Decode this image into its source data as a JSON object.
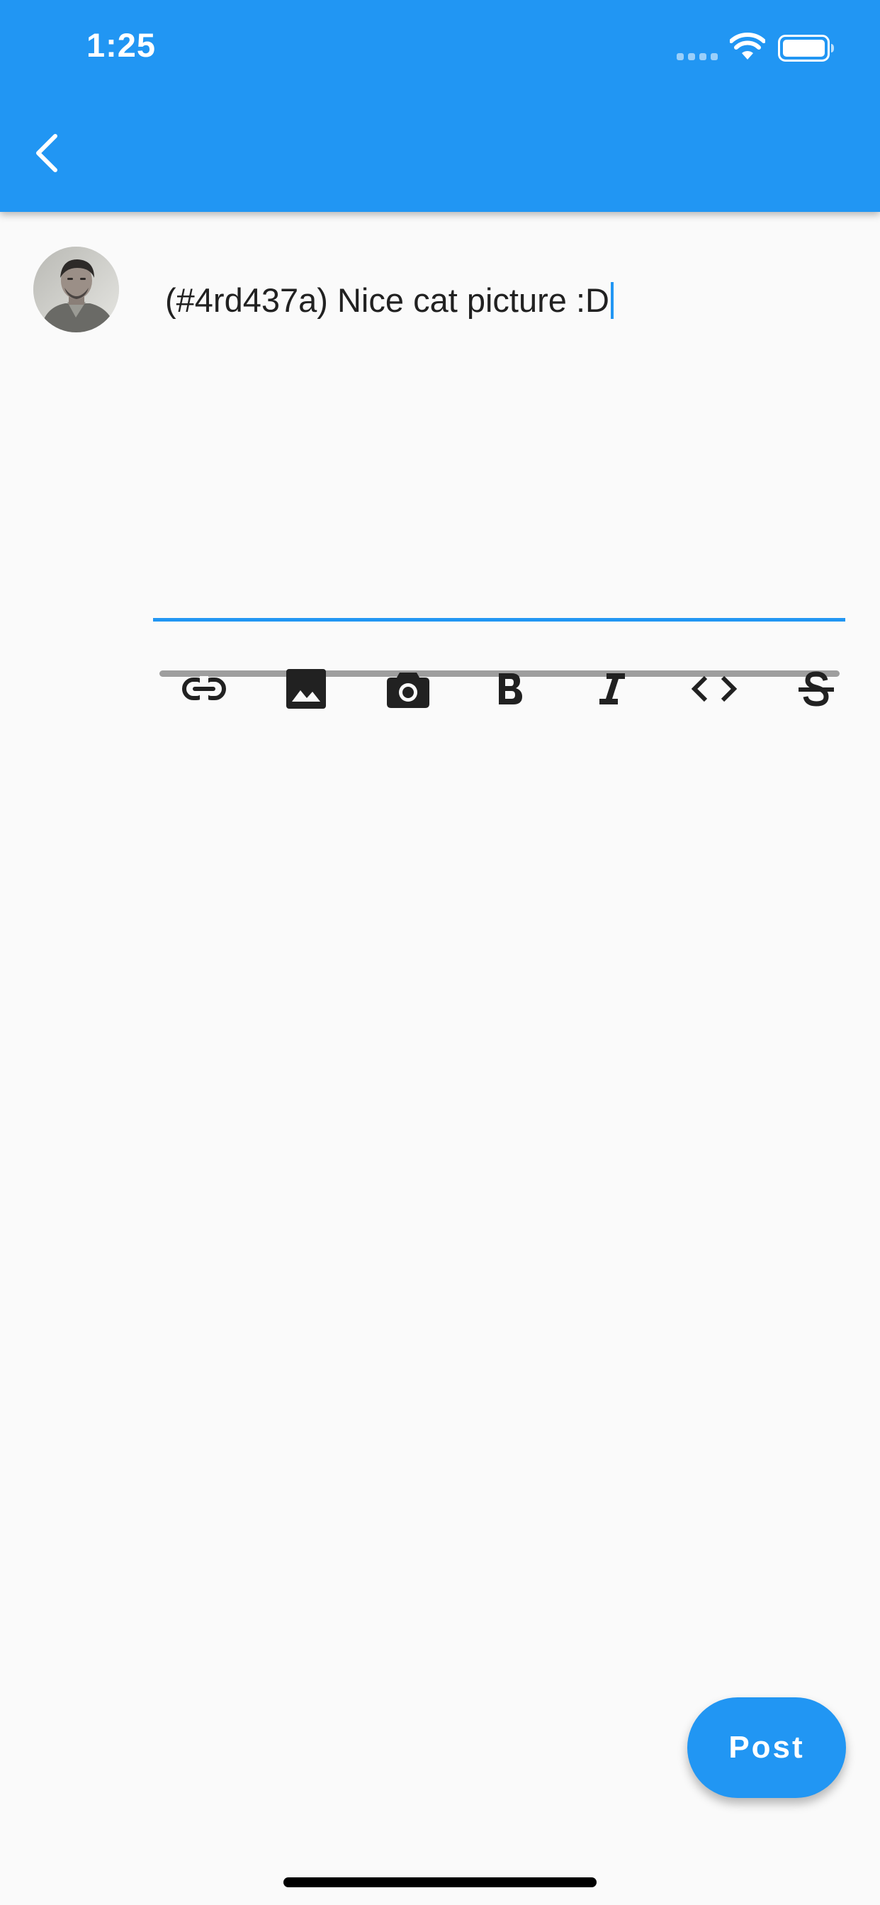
{
  "status_bar": {
    "time": "1:25",
    "icons": [
      "signal-dots-icon",
      "wifi-icon",
      "battery-icon"
    ]
  },
  "app_bar": {
    "back_icon": "chevron-left-icon"
  },
  "composer": {
    "avatar": "user-avatar",
    "text": "(#4rd437a) Nice cat picture :D"
  },
  "toolbar": {
    "tools": [
      "link-icon",
      "image-icon",
      "camera-icon",
      "bold-icon",
      "italic-icon",
      "code-icon",
      "strikethrough-icon"
    ]
  },
  "post_button": {
    "label": "Post"
  },
  "colors": {
    "primary": "#2196f3",
    "background": "#fafafa",
    "text": "#212121",
    "icon": "#212121",
    "track": "#9e9e9e"
  }
}
